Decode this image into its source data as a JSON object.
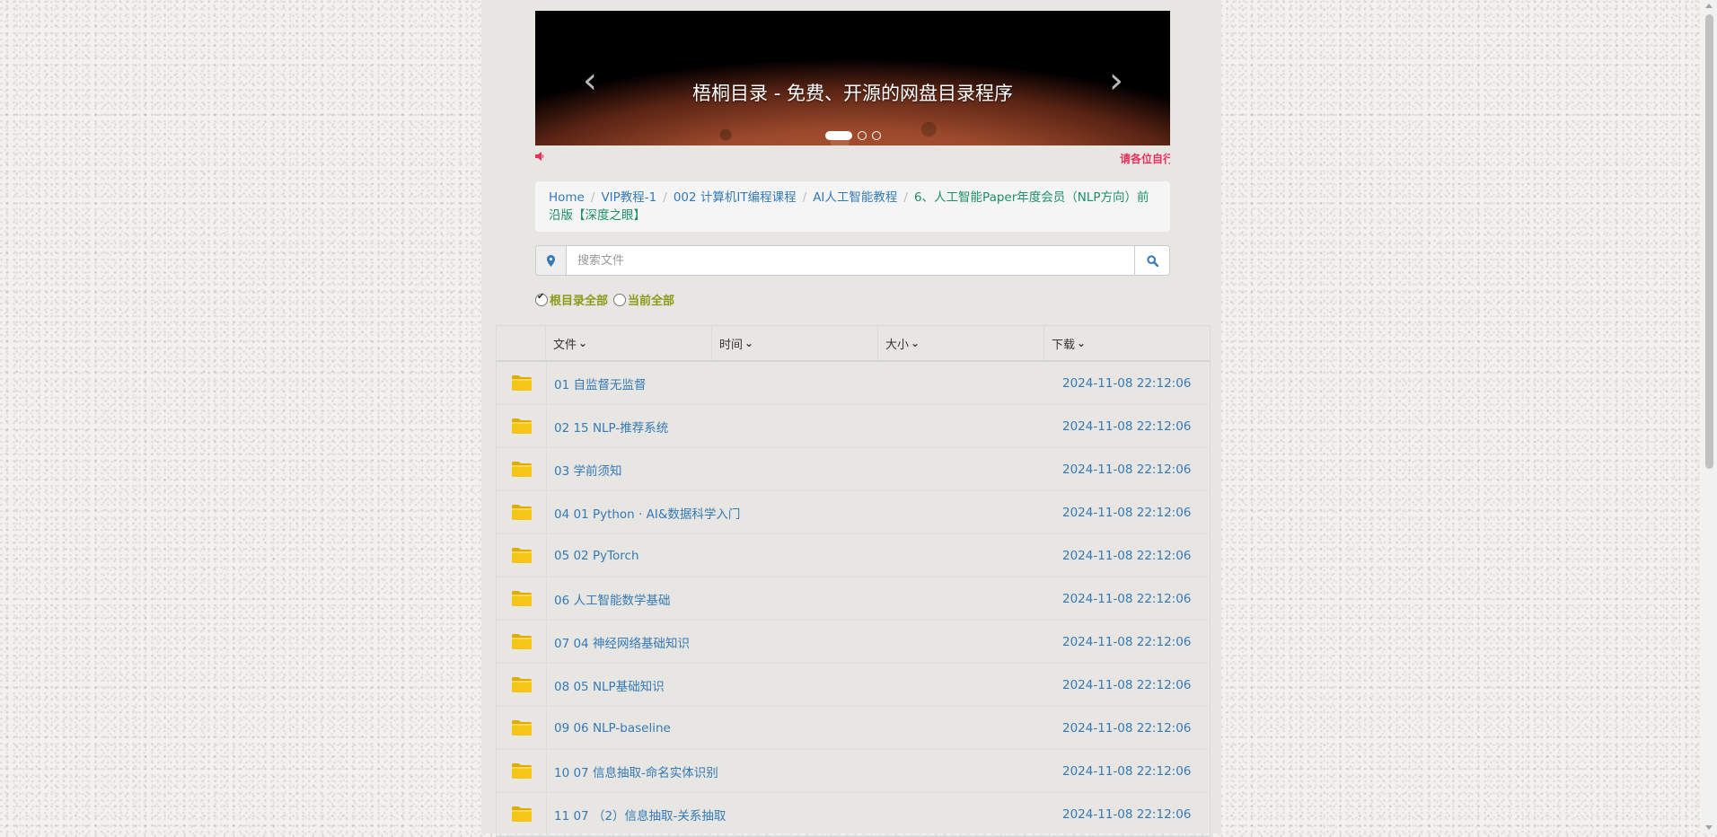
{
  "carousel": {
    "caption": "梧桐目录 - 免费、开源的网盘目录程序",
    "prev_glyph": "‹",
    "next_glyph": "›",
    "slides_count": 3,
    "active_slide": 1
  },
  "marquee": {
    "text": "请各位自行"
  },
  "breadcrumb": {
    "items": [
      "Home",
      "VIP教程-1",
      "002 计算机IT编程课程",
      "AI人工智能教程"
    ],
    "current": "6、人工智能Paper年度会员（NLP方向）前沿版【深度之眼】"
  },
  "search": {
    "placeholder": "搜索文件"
  },
  "scope": {
    "options": [
      "根目录全部",
      "当前全部"
    ],
    "selected": "根目录全部"
  },
  "table": {
    "headers": {
      "file": "文件",
      "time": "时间",
      "size": "大小",
      "download": "下载"
    },
    "rows": [
      {
        "name": "01 自监督无监督",
        "time": "2024-11-08 22:12:06"
      },
      {
        "name": "02 15 NLP-推荐系统",
        "time": "2024-11-08 22:12:06"
      },
      {
        "name": "03 学前须知",
        "time": "2024-11-08 22:12:06"
      },
      {
        "name": "04 01 Python · AI&数据科学入门",
        "time": "2024-11-08 22:12:06"
      },
      {
        "name": "05 02 PyTorch",
        "time": "2024-11-08 22:12:06"
      },
      {
        "name": "06 人工智能数学基础",
        "time": "2024-11-08 22:12:06"
      },
      {
        "name": "07 04 神经网络基础知识",
        "time": "2024-11-08 22:12:06"
      },
      {
        "name": "08 05 NLP基础知识",
        "time": "2024-11-08 22:12:06"
      },
      {
        "name": "09 06 NLP-baseline",
        "time": "2024-11-08 22:12:06"
      },
      {
        "name": "10 07 信息抽取-命名实体识别",
        "time": "2024-11-08 22:12:06"
      },
      {
        "name": "11 07 （2）信息抽取-关系抽取",
        "time": "2024-11-08 22:12:06"
      }
    ]
  },
  "colors": {
    "link": "#337ab7",
    "breadcrumb_current": "#1b8f67",
    "marquee": "#e8305c",
    "scope_label": "#8a9a1a",
    "folder": "#f5c518"
  },
  "icons": {
    "row_icon": "folder-icon",
    "search_addon": "map-marker-icon",
    "search_button": "search-icon",
    "marquee_icon": "speaker-icon"
  }
}
